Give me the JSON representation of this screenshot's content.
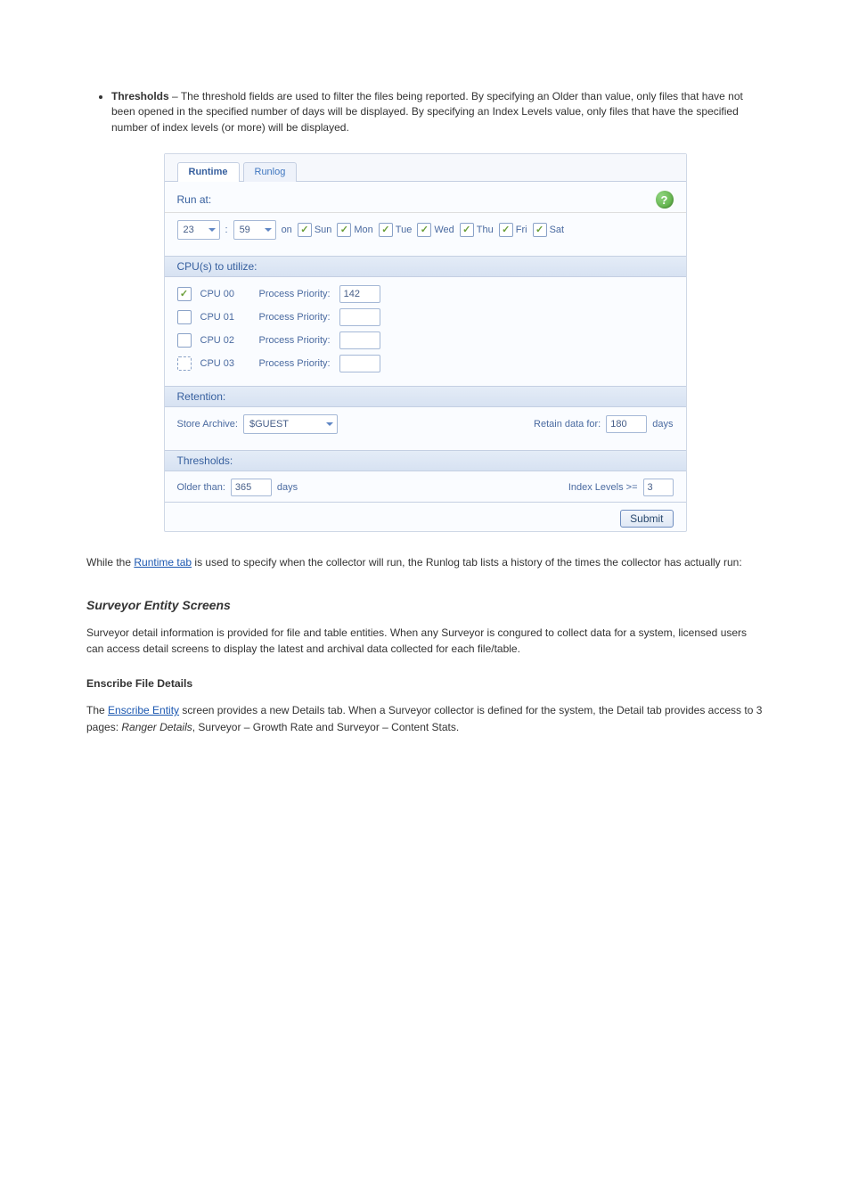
{
  "desc_list_item": {
    "term": "Thresholds",
    "text": " – The threshold fields are used to filter the files being reported. By specifying an Older than value, only files that have not been opened in the specified number of days will be displayed. By specifying an Index Levels value, only files that have the specified number of index levels (or more) will be displayed."
  },
  "panel": {
    "tabs": {
      "runtime": "Runtime",
      "runlog": "Runlog"
    },
    "run_at_label": "Run at:",
    "hour": "23",
    "minute": "59",
    "on_label": "on",
    "days": [
      {
        "label": "Sun",
        "checked": true
      },
      {
        "label": "Mon",
        "checked": true
      },
      {
        "label": "Tue",
        "checked": true
      },
      {
        "label": "Wed",
        "checked": true
      },
      {
        "label": "Thu",
        "checked": true
      },
      {
        "label": "Fri",
        "checked": true
      },
      {
        "label": "Sat",
        "checked": true
      }
    ],
    "cpu_section_label": "CPU(s) to utilize:",
    "cpus": [
      {
        "label": "CPU 00",
        "checked": true,
        "dashed": false,
        "priority_label": "Process Priority:",
        "priority": "142"
      },
      {
        "label": "CPU 01",
        "checked": false,
        "dashed": false,
        "priority_label": "Process Priority:",
        "priority": ""
      },
      {
        "label": "CPU 02",
        "checked": false,
        "dashed": false,
        "priority_label": "Process Priority:",
        "priority": ""
      },
      {
        "label": "CPU 03",
        "checked": false,
        "dashed": true,
        "priority_label": "Process Priority:",
        "priority": ""
      }
    ],
    "retention": {
      "head": "Retention:",
      "store_label": "Store Archive:",
      "store_value": "$GUEST",
      "retain_label": "Retain data for:",
      "retain_value": "180",
      "days_unit": "days"
    },
    "thresholds": {
      "head": "Thresholds:",
      "older_label": "Older than:",
      "older_value": "365",
      "days_unit": "days",
      "index_label": "Index Levels >=",
      "index_value": "3"
    },
    "submit_label": "Submit"
  },
  "paras": {
    "p1_a": "While the ",
    "p1_link": "Runtime tab",
    "p1_b": " is used to specify when the collector will run, the Runlog tab lists a history of the times the collector has actually run:",
    "h3": "Surveyor Entity Screens",
    "p2": "Surveyor detail information is provided for file and table entities. When any Surveyor is congured to collect data for a system, licensed users can access detail screens to display the latest and archival data collected for each file/table.",
    "h4": "Enscribe File Details",
    "p3_a": "The ",
    "p3_link": "Enscribe Entity",
    "p3_b": " screen provides a new Details tab. When a Surveyor collector is defined for the system, the Detail tab provides access to 3 pages:",
    "p3_ranger": "Ranger Details",
    "p3_c": ", Surveyor – Growth Rate and Surveyor – Content Stats."
  }
}
